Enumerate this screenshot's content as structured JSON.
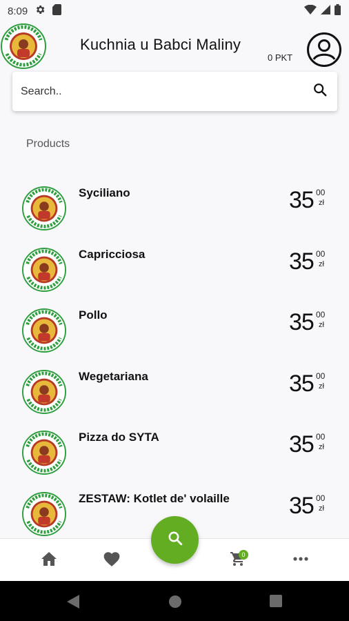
{
  "status_bar": {
    "time": "8:09"
  },
  "header": {
    "title": "Kuchnia u Babci Maliny",
    "points": "0 PKT"
  },
  "search": {
    "placeholder": "Search.."
  },
  "section_title": "Products",
  "products": [
    {
      "name": "Syciliano",
      "price_main": "35",
      "price_cents": "00",
      "currency": "zł"
    },
    {
      "name": "Capricciosa",
      "price_main": "35",
      "price_cents": "00",
      "currency": "zł"
    },
    {
      "name": "Pollo",
      "price_main": "35",
      "price_cents": "00",
      "currency": "zł"
    },
    {
      "name": "Wegetariana",
      "price_main": "35",
      "price_cents": "00",
      "currency": "zł"
    },
    {
      "name": "Pizza do SYTA",
      "price_main": "35",
      "price_cents": "00",
      "currency": "zł"
    },
    {
      "name": "ZESTAW: Kotlet de' volaille",
      "price_main": "35",
      "price_cents": "00",
      "currency": "zł"
    }
  ],
  "logo_text": {
    "top": "UMALINY.PL",
    "bottom": "SMAK OBIADU"
  },
  "cart": {
    "count": "0"
  },
  "icons": {
    "settings": "gear-icon",
    "sd": "sd-card-icon",
    "wifi": "wifi-icon",
    "signal": "signal-icon",
    "battery": "battery-icon",
    "account": "account-circle-icon",
    "search": "search-icon",
    "home": "home-icon",
    "favorite": "heart-icon",
    "cart": "cart-icon",
    "more": "more-horiz-icon",
    "back": "back-triangle-icon",
    "home_sys": "home-circle-icon",
    "recents": "recents-square-icon"
  },
  "colors": {
    "accent": "#62ad22",
    "logo_red": "#c0392b",
    "logo_green": "#2e9e3e"
  }
}
